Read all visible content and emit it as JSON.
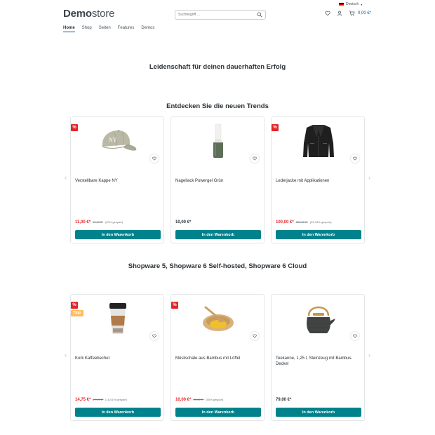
{
  "topbar": {
    "language": "Deutsch"
  },
  "header": {
    "logo_bold": "Demo",
    "logo_light": "store",
    "search_placeholder": "Suchbegriff ...",
    "cart_total": "0,00 €*"
  },
  "nav": {
    "items": [
      "Home",
      "Shop",
      "Seiten",
      "Features",
      "Demos"
    ],
    "active": "Home"
  },
  "headings": {
    "hero": "Leidenschaft für deinen dauerhaften Erfolg",
    "trends": "Entdecken Sie die neuen Trends",
    "shopware": "Shopware 5, Shopware 6 Self-hosted, Shopware 6 Cloud"
  },
  "colors": {
    "accent": "#00828c",
    "sale": "#e52427",
    "tip": "#ffbd5d",
    "link": "#0b539b"
  },
  "slider1": {
    "products": [
      {
        "name": "Verstellbare Kappe NY",
        "price": "11,00 €*",
        "old_price": "19,99 €*",
        "discount": "(50% gespart)",
        "badge": "%",
        "tip": "",
        "image": "cap"
      },
      {
        "name": "Nagellack Powergel Grün",
        "price": "10,00 €*",
        "old_price": "",
        "discount": "",
        "badge": "",
        "tip": "",
        "image": "nail-polish"
      },
      {
        "name": "Lederjacke mit Applikationen",
        "price": "100,00 €*",
        "old_price": "150,00 €*",
        "discount": "(33,33% gespart)",
        "badge": "%",
        "tip": "",
        "image": "leather-jacket"
      }
    ],
    "button_label": "In den Warenkorb"
  },
  "slider2": {
    "products": [
      {
        "name": "Kork Kaffeebecher",
        "price": "14,75 €*",
        "old_price": "17,99 €*",
        "discount": "(18,01% gespart)",
        "badge": "%",
        "tip": "Tipp",
        "image": "coffee-cup"
      },
      {
        "name": "Müslischale aus Bambus mit Löffel",
        "price": "10,00 €*",
        "old_price": "20,00 €*",
        "discount": "(50% gespart)",
        "badge": "%",
        "tip": "",
        "image": "bamboo-bowl"
      },
      {
        "name": "Teekanne, 1,25 l, Steinzeug mit Bambus-Deckel",
        "price": "79,00 €*",
        "old_price": "",
        "discount": "",
        "badge": "",
        "tip": "",
        "image": "teapot"
      }
    ],
    "button_label": "In den Warenkorb"
  }
}
